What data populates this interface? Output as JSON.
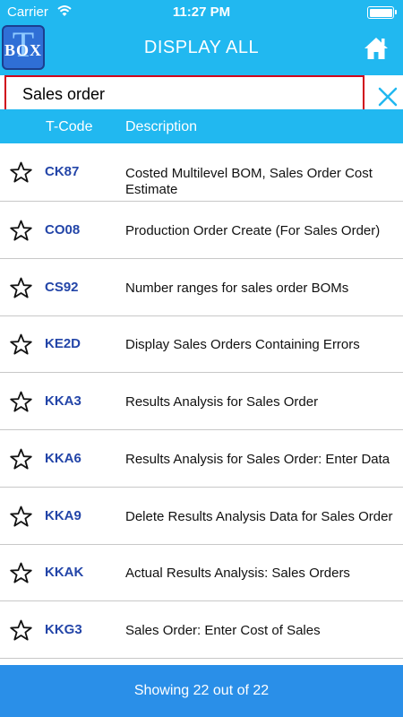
{
  "status_bar": {
    "carrier": "Carrier",
    "time": "11:27 PM"
  },
  "header": {
    "logo_t": "T",
    "logo_box": "BOX",
    "title": "DISPLAY ALL"
  },
  "search": {
    "value": "Sales order",
    "placeholder": ""
  },
  "columns": {
    "tcode": "T-Code",
    "description": "Description"
  },
  "rows": [
    {
      "tcode": "CK87",
      "description": "Costed Multilevel BOM, Sales Order Cost Estimate"
    },
    {
      "tcode": "CO08",
      "description": "Production Order Create (For Sales Order)"
    },
    {
      "tcode": "CS92",
      "description": "Number ranges for sales order BOMs"
    },
    {
      "tcode": "KE2D",
      "description": "Display Sales Orders Containing Errors"
    },
    {
      "tcode": "KKA3",
      "description": "Results Analysis for Sales Order"
    },
    {
      "tcode": "KKA6",
      "description": "Results Analysis for Sales Order: Enter Data"
    },
    {
      "tcode": "KKA9",
      "description": "Delete Results Analysis Data for Sales Order"
    },
    {
      "tcode": "KKAK",
      "description": "Actual Results Analysis: Sales Orders"
    },
    {
      "tcode": "KKG3",
      "description": "Sales Order: Enter Cost of Sales"
    }
  ],
  "footer": {
    "text": "Showing 22 out of 22"
  },
  "colors": {
    "header": "#21b8f0",
    "footer": "#2a8fe8",
    "tcode": "#2345a8",
    "search_border": "#d0021b"
  },
  "icons": {
    "wifi": "wifi-icon",
    "battery": "battery-icon",
    "home": "home-icon",
    "clear": "close-icon",
    "favorite": "star-outline-icon"
  }
}
